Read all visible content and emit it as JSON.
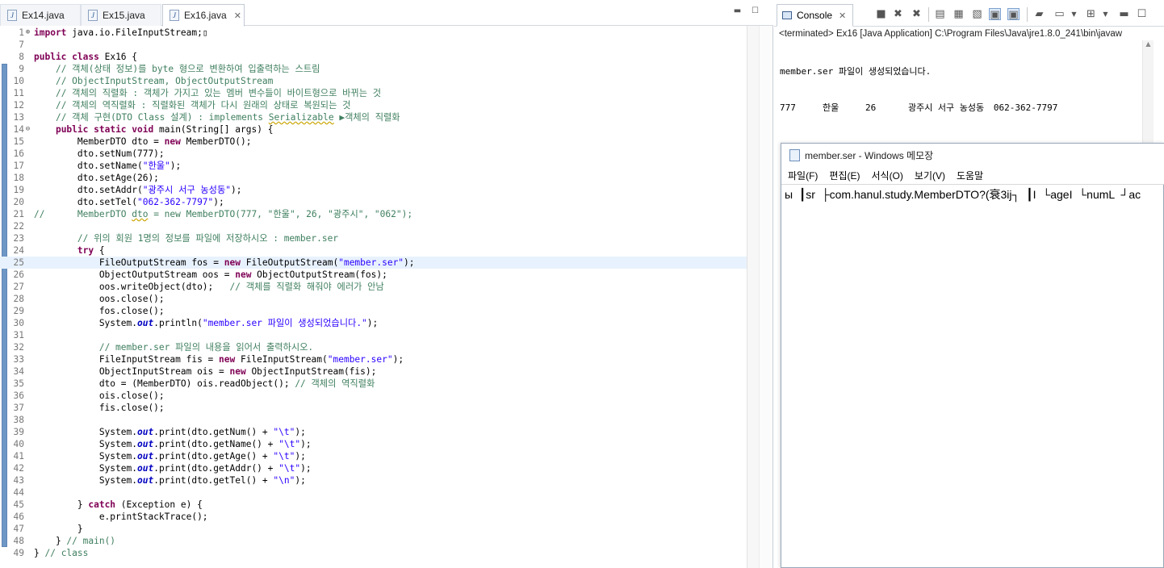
{
  "editor": {
    "tabs": [
      {
        "label": "Ex14.java",
        "active": false
      },
      {
        "label": "Ex15.java",
        "active": false
      },
      {
        "label": "Ex16.java",
        "active": true
      }
    ],
    "highlighted_line": "25"
  },
  "console": {
    "tab_label": "Console",
    "status": "<terminated> Ex16 [Java Application] C:\\Program Files\\Java\\jre1.8.0_241\\bin\\javaw",
    "output": [
      "member.ser 파일이 생성되었습니다.",
      "777\t한울\t26\t광주시 서구 농성동\t062-362-7797"
    ]
  },
  "notepad": {
    "title": "member.ser - Windows 메모장",
    "menu": [
      "파일(F)",
      "편집(E)",
      "서식(O)",
      "보기(V)",
      "도움말"
    ],
    "content": "ы  ┃sr  ├com.hanul.study.MemberDTO?(衰3ij┐  ┃I  └ageI  └numL  ┘ac"
  },
  "icons": [
    "java-file-icon",
    "console-icon",
    "notepad-icon"
  ]
}
